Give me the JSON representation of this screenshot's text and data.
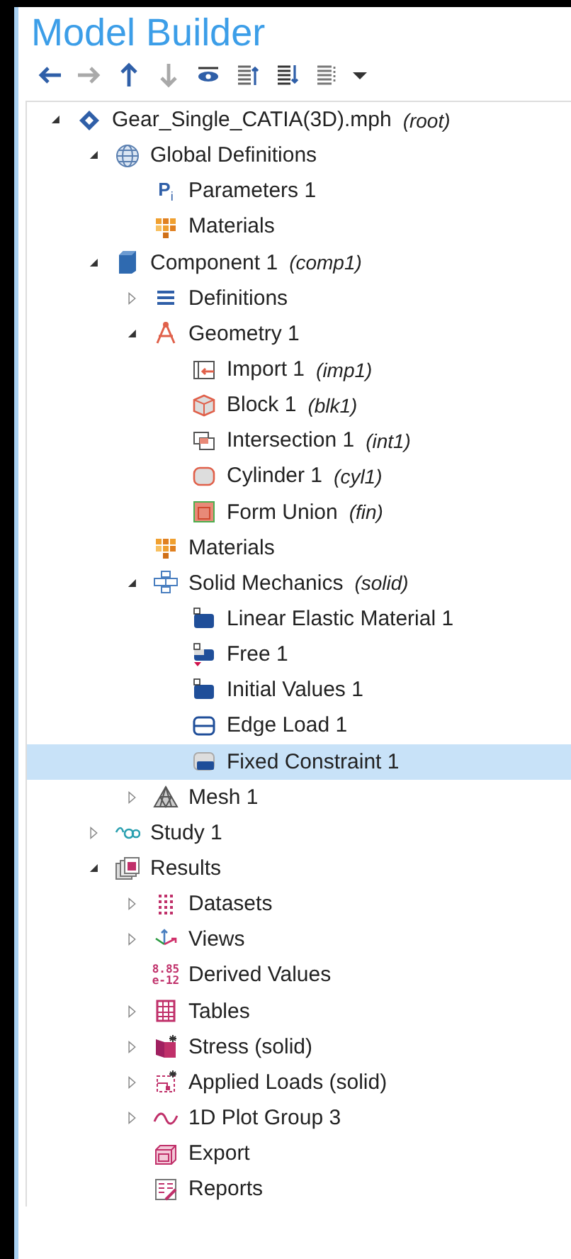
{
  "panel": {
    "title": "Model Builder"
  },
  "toolbar": [
    {
      "kind": "back",
      "disabled": false
    },
    {
      "kind": "forward",
      "disabled": true
    },
    {
      "kind": "up",
      "disabled": false
    },
    {
      "kind": "down",
      "disabled": true
    },
    {
      "kind": "show"
    },
    {
      "kind": "collapse"
    },
    {
      "kind": "expand"
    },
    {
      "kind": "list"
    },
    {
      "kind": "dropdown"
    }
  ],
  "tree": [
    {
      "label": "Gear_Single_CATIA(3D).mph",
      "tag": "(root)",
      "kind": "model",
      "expanded": true,
      "selected": false,
      "children": [
        {
          "label": "Global Definitions",
          "kind": "globe",
          "expanded": true,
          "selected": false,
          "children": [
            {
              "label": "Parameters 1",
              "kind": "text",
              "icon_text": "P$_{i}$",
              "selected": false
            },
            {
              "label": "Materials",
              "kind": "materials",
              "selected": false
            }
          ]
        },
        {
          "label": "Component 1",
          "tag": "(comp1)",
          "kind": "component",
          "expanded": true,
          "selected": false,
          "children": [
            {
              "label": "Definitions",
              "kind": "definitions",
              "expanded": false,
              "selected": false
            },
            {
              "label": "Geometry 1",
              "kind": "geometry",
              "expanded": true,
              "selected": false,
              "children": [
                {
                  "label": "Import 1",
                  "tag": "(imp1)",
                  "kind": "import",
                  "selected": false
                },
                {
                  "label": "Block 1",
                  "tag": "(blk1)",
                  "kind": "block",
                  "selected": false
                },
                {
                  "label": "Intersection 1",
                  "tag": "(int1)",
                  "kind": "intersection",
                  "selected": false
                },
                {
                  "label": "Cylinder 1",
                  "tag": "(cyl1)",
                  "kind": "cylinder",
                  "selected": false
                },
                {
                  "label": "Form Union",
                  "tag": "(fin)",
                  "kind": "union",
                  "selected": false
                }
              ]
            },
            {
              "label": "Materials",
              "kind": "materials",
              "selected": false
            },
            {
              "label": "Solid Mechanics",
              "tag": "(solid)",
              "kind": "physics",
              "expanded": true,
              "selected": false,
              "children": [
                {
                  "label": "Linear Elastic Material 1",
                  "kind": "domain",
                  "selected": false
                },
                {
                  "label": "Free 1",
                  "kind": "domain-free",
                  "selected": false
                },
                {
                  "label": "Initial Values 1",
                  "kind": "domain",
                  "selected": false
                },
                {
                  "label": "Edge Load 1",
                  "kind": "edge",
                  "selected": false
                },
                {
                  "label": "Fixed Constraint 1",
                  "kind": "boundary",
                  "selected": true
                }
              ]
            },
            {
              "label": "Mesh 1",
              "kind": "mesh",
              "expanded": false,
              "selected": false
            }
          ]
        },
        {
          "label": "Study 1",
          "kind": "study",
          "expanded": false,
          "selected": false
        },
        {
          "label": "Results",
          "kind": "results",
          "expanded": true,
          "selected": false,
          "children": [
            {
              "label": "Datasets",
              "kind": "datasets",
              "expanded": false,
              "selected": false
            },
            {
              "label": "Views",
              "kind": "views",
              "expanded": false,
              "selected": false
            },
            {
              "label": "Derived Values",
              "kind": "text2",
              "icon_text": "8.85",
              "icon_text2": "e-12",
              "selected": false
            },
            {
              "label": "Tables",
              "kind": "tables",
              "expanded": false,
              "selected": false
            },
            {
              "label": "Stress (solid)",
              "kind": "plot3d",
              "expanded": false,
              "selected": false
            },
            {
              "label": "Applied Loads (solid)",
              "kind": "plotloads",
              "expanded": false,
              "selected": false
            },
            {
              "label": "1D Plot Group 3",
              "kind": "plot1d",
              "expanded": false,
              "selected": false
            },
            {
              "label": "Export",
              "kind": "export",
              "selected": false
            },
            {
              "label": "Reports",
              "kind": "reports",
              "selected": false
            }
          ]
        }
      ]
    }
  ]
}
